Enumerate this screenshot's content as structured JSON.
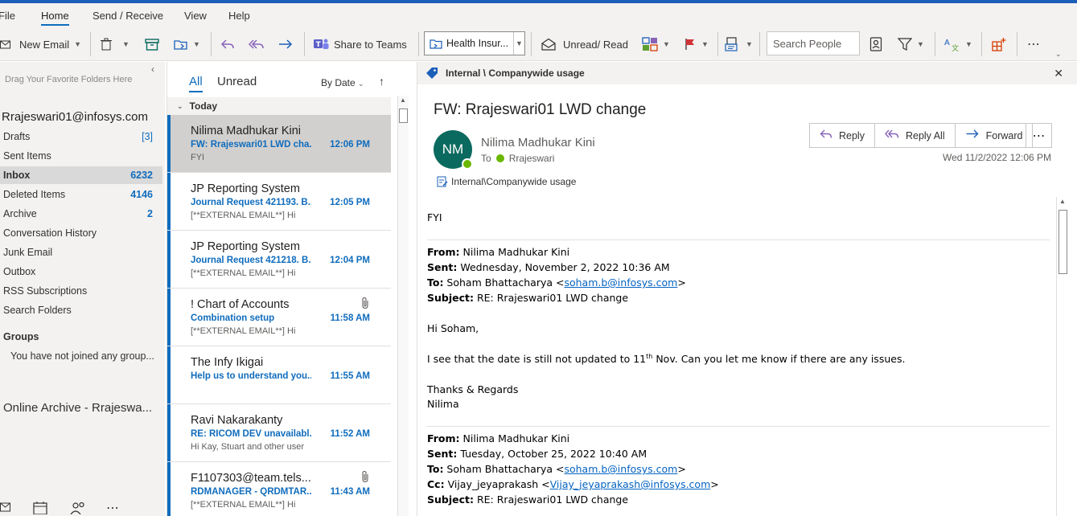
{
  "tabs": [
    "File",
    "Home",
    "Send / Receive",
    "View",
    "Help"
  ],
  "ribbon": {
    "new_email": "New Email",
    "share_to_teams": "Share to Teams",
    "quick_step": "Health Insur...",
    "unread_read": "Unread/ Read",
    "search_people_placeholder": "Search People"
  },
  "folder_pane": {
    "hint": "Drag Your Favorite Folders Here",
    "account": "Rrajeswari01@infosys.com",
    "folders": [
      {
        "name": "Drafts",
        "count": "[3]"
      },
      {
        "name": "Sent Items",
        "count": ""
      },
      {
        "name": "Inbox",
        "count": "6232"
      },
      {
        "name": "Deleted Items",
        "count": "4146"
      },
      {
        "name": "Archive",
        "count": "2"
      },
      {
        "name": "Conversation History",
        "count": ""
      },
      {
        "name": "Junk Email",
        "count": ""
      },
      {
        "name": "Outbox",
        "count": ""
      },
      {
        "name": "RSS Subscriptions",
        "count": ""
      },
      {
        "name": "Search Folders",
        "count": ""
      }
    ],
    "groups_heading": "Groups",
    "groups_text": "You have not joined any group...",
    "online_archive": "Online Archive - Rrajeswa..."
  },
  "message_list": {
    "filter_all": "All",
    "filter_unread": "Unread",
    "sort": "By Date",
    "group": "Today",
    "messages": [
      {
        "from": "Nilima Madhukar Kini",
        "subject": "FW: Rrajeswari01 LWD cha...",
        "time": "12:06 PM",
        "preview": "FYI"
      },
      {
        "from": "JP Reporting System",
        "subject": "Journal Request 421193. B...",
        "time": "12:05 PM",
        "preview": "[**EXTERNAL EMAIL**]  Hi"
      },
      {
        "from": "JP Reporting System",
        "subject": "Journal Request 421218. B...",
        "time": "12:04 PM",
        "preview": "[**EXTERNAL EMAIL**]  Hi"
      },
      {
        "from": "! Chart of Accounts",
        "subject": "Combination setup",
        "time": "11:58 AM",
        "preview": "[**EXTERNAL EMAIL**]  Hi"
      },
      {
        "from": "The Infy Ikigai",
        "subject": "Help us to understand you...",
        "time": "11:55 AM",
        "preview": ""
      },
      {
        "from": "Ravi Nakarakanty",
        "subject": "RE: RICOM DEV unavailabl...",
        "time": "11:52 AM",
        "preview": "Hi Kay,  Stuart and other user"
      },
      {
        "from": "F1107303@team.tels...",
        "subject": "RDMANAGER - QRDMTAR...",
        "time": "11:43 AM",
        "preview": "[**EXTERNAL EMAIL**]  Hi"
      }
    ]
  },
  "reading": {
    "infobar": "Internal \\ Companywide usage",
    "subject": "FW: Rrajeswari01 LWD change",
    "avatar_initials": "NM",
    "sender": "Nilima Madhukar Kini",
    "to_label": "To",
    "to_name": "Rrajeswari",
    "reply": "Reply",
    "reply_all": "Reply All",
    "forward": "Forward",
    "date": "Wed 11/2/2022 12:06 PM",
    "label": "Internal\\Companywide usage",
    "body": {
      "fyi": "FYI",
      "m1_from_label": "From:",
      "m1_from": " Nilima Madhukar Kini",
      "m1_sent_label": "Sent:",
      "m1_sent": " Wednesday, November 2, 2022 10:36 AM",
      "m1_to_label": "To:",
      "m1_to": " Soham Bhattacharya <",
      "m1_to_email": "soham.b@infosys.com",
      "m1_to_end": ">",
      "m1_subject_label": "Subject:",
      "m1_subject": " RE: Rrajeswari01 LWD change",
      "greeting": "Hi Soham,",
      "text_a": "I see  that the date is still not updated to 11",
      "text_sup": "th",
      "text_b": " Nov. Can you let me know if there are any issues.",
      "thanks": "Thanks & Regards",
      "signature": "Nilima",
      "m2_from_label": "From:",
      "m2_from": " Nilima Madhukar Kini",
      "m2_sent_label": "Sent:",
      "m2_sent": " Tuesday, October 25, 2022 10:40 AM",
      "m2_to_label": "To:",
      "m2_to": " Soham Bhattacharya <",
      "m2_to_email": "soham.b@infosys.com",
      "m2_to_end": ">",
      "m2_cc_label": "Cc:",
      "m2_cc": " Vijay_jeyaprakash <",
      "m2_cc_email": "Vijay_jeyaprakash@infosys.com",
      "m2_cc_end": ">",
      "m2_subject_label": "Subject:",
      "m2_subject": " RE: Rrajeswari01 LWD change"
    }
  }
}
